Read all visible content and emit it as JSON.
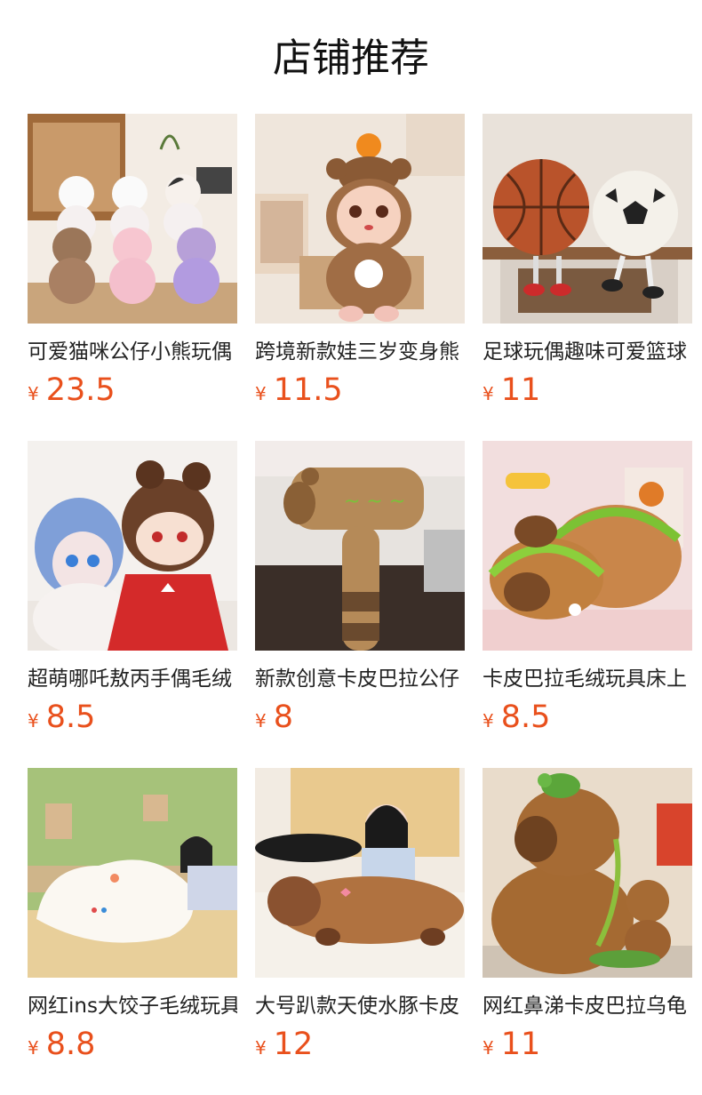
{
  "page": {
    "title": "店铺推荐"
  },
  "colors": {
    "price": "#e9501c",
    "title": "#111111",
    "text": "#222222",
    "background": "#ffffff"
  },
  "products": [
    {
      "name": "可爱猫咪公仔小熊玩偶",
      "currency": "¥",
      "price": "23.5",
      "image": "plush-cats-bears-image"
    },
    {
      "name": "跨境新款娃三岁变身熊",
      "currency": "¥",
      "price": "11.5",
      "image": "bear-costume-doll-image"
    },
    {
      "name": "足球玩偶趣味可爱篮球",
      "currency": "¥",
      "price": "11",
      "image": "basketball-football-plush-image"
    },
    {
      "name": "超萌哪吒敖丙手偶毛绒",
      "currency": "¥",
      "price": "8.5",
      "image": "nezha-aobing-puppet-image"
    },
    {
      "name": "新款创意卡皮巴拉公仔",
      "currency": "¥",
      "price": "8",
      "image": "capybara-hammer-plush-image"
    },
    {
      "name": "卡皮巴拉毛绒玩具床上",
      "currency": "¥",
      "price": "8.5",
      "image": "capybara-taco-plush-image"
    },
    {
      "name": "网红ins大饺子毛绒玩具",
      "currency": "¥",
      "price": "8.8",
      "image": "dumpling-pillow-image"
    },
    {
      "name": "大号趴款天使水豚卡皮",
      "currency": "¥",
      "price": "12",
      "image": "lying-capybara-pillow-image"
    },
    {
      "name": "网红鼻涕卡皮巴拉乌龟",
      "currency": "¥",
      "price": "11",
      "image": "capybara-turtle-plush-image"
    }
  ]
}
